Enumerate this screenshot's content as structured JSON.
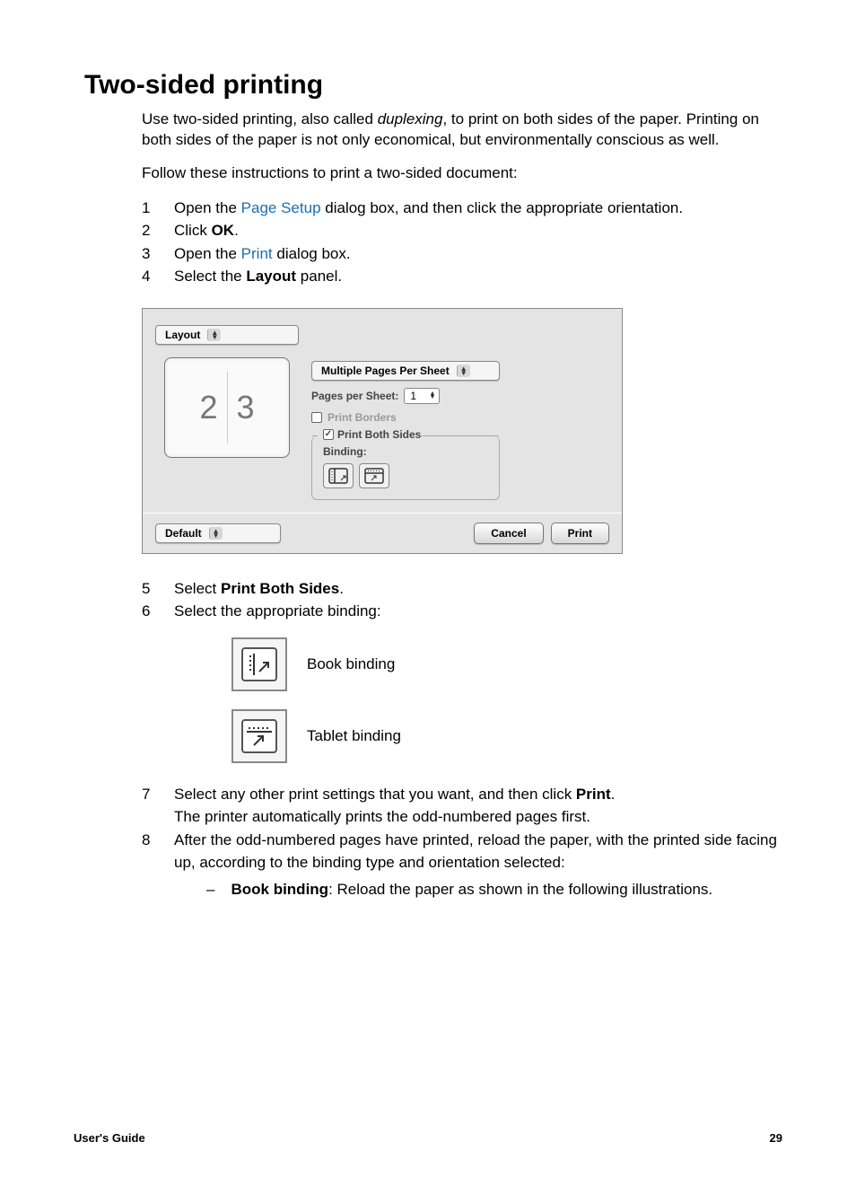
{
  "heading": "Two-sided printing",
  "intro": {
    "prefix": "Use two-sided printing, also called ",
    "italic": "duplexing",
    "suffix": ", to print on both sides of the paper. Printing on both sides of the paper is not only economical, but environmentally conscious as well."
  },
  "instructions_lead": "Follow these instructions to print a two-sided document:",
  "steps1": [
    {
      "num": "1",
      "parts": [
        {
          "t": "Open the "
        },
        {
          "t": "Page Setup",
          "link": true
        },
        {
          "t": " dialog box, and then click the appropriate orientation."
        }
      ]
    },
    {
      "num": "2",
      "parts": [
        {
          "t": "Click "
        },
        {
          "t": "OK",
          "bold": true
        },
        {
          "t": "."
        }
      ]
    },
    {
      "num": "3",
      "parts": [
        {
          "t": "Open the "
        },
        {
          "t": "Print",
          "link": true
        },
        {
          "t": " dialog box."
        }
      ]
    },
    {
      "num": "4",
      "parts": [
        {
          "t": "Select the "
        },
        {
          "t": "Layout",
          "bold": true
        },
        {
          "t": " panel."
        }
      ]
    }
  ],
  "dialog": {
    "panel_select": "Layout",
    "mode_select": "Multiple Pages Per Sheet",
    "pages_label": "Pages per Sheet:",
    "pages_value": "1",
    "borders_label": "Print Borders",
    "both_sides_label": "Print Both Sides",
    "binding_label": "Binding:",
    "preset_select": "Default",
    "cancel_btn": "Cancel",
    "print_btn": "Print",
    "preview": {
      "a": "2",
      "b": "3"
    }
  },
  "steps2": [
    {
      "num": "5",
      "parts": [
        {
          "t": "Select "
        },
        {
          "t": "Print Both Sides",
          "bold": true
        },
        {
          "t": "."
        }
      ]
    },
    {
      "num": "6",
      "parts": [
        {
          "t": "Select the appropriate binding:"
        }
      ]
    }
  ],
  "binding_options": [
    {
      "name": "book-binding-icon",
      "label": "Book binding"
    },
    {
      "name": "tablet-binding-icon",
      "label": "Tablet binding"
    }
  ],
  "steps3": [
    {
      "num": "7",
      "parts": [
        {
          "t": "Select any other print settings that you want, and then click "
        },
        {
          "t": "Print",
          "bold": true
        },
        {
          "t": "."
        }
      ],
      "after": "The printer automatically prints the odd-numbered pages first."
    },
    {
      "num": "8",
      "parts": [
        {
          "t": "After the odd-numbered pages have printed, reload the paper, with the printed side facing up, according to the binding type and orientation selected:"
        }
      ],
      "sub": {
        "dash": "–",
        "parts": [
          {
            "t": "Book binding",
            "bold": true
          },
          {
            "t": ": Reload the paper as shown in the following illustrations."
          }
        ]
      }
    }
  ],
  "footer": {
    "left": "User's Guide",
    "right": "29"
  }
}
